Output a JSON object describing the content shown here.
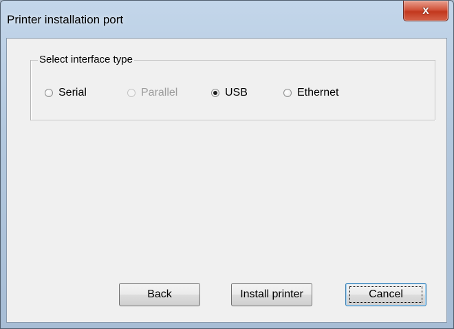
{
  "window": {
    "title": "Printer installation port",
    "close_glyph": "x",
    "close_icon": "close-icon"
  },
  "interface_group": {
    "label": "Select interface type",
    "options": [
      {
        "label": "Serial",
        "checked": false,
        "enabled": true
      },
      {
        "label": "Parallel",
        "checked": false,
        "enabled": false
      },
      {
        "label": "USB",
        "checked": true,
        "enabled": true
      },
      {
        "label": "Ethernet",
        "checked": false,
        "enabled": true
      }
    ]
  },
  "buttons": {
    "back_label": "Back",
    "install_label": "Install printer",
    "cancel_label": "Cancel"
  },
  "colors": {
    "title_bar": "#b9cde3",
    "close_button": "#c8462b",
    "dialog_face": "#f0f0f0",
    "disabled_text": "#9c9c9c"
  }
}
